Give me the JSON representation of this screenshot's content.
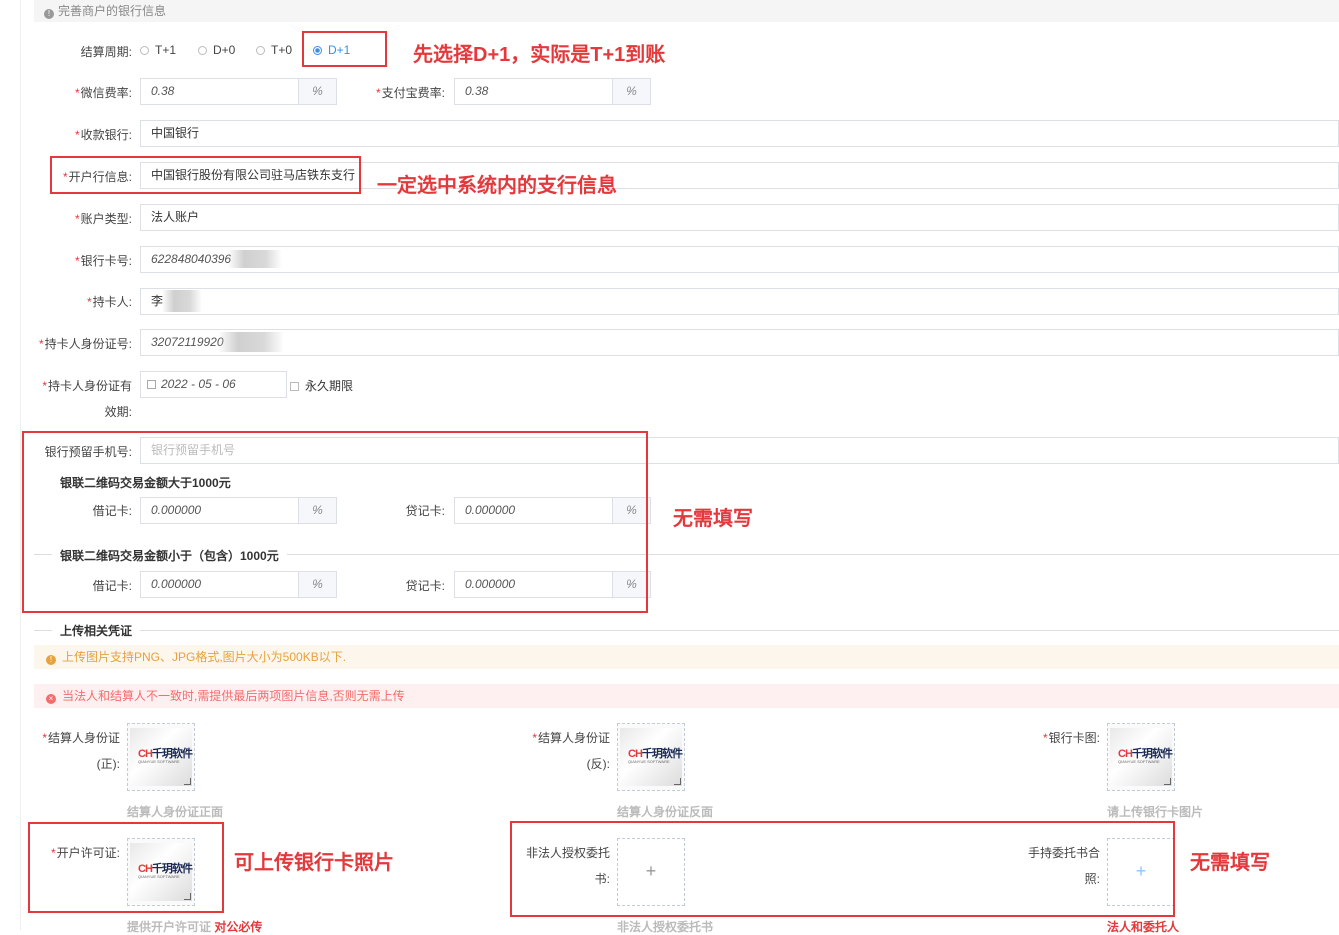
{
  "section_header": "完善商户的银行信息",
  "settlement": {
    "label": "结算周期:",
    "options": [
      "T+1",
      "D+0",
      "T+0",
      "D+1"
    ],
    "selected": "D+1"
  },
  "wechat_rate": {
    "label": "微信费率:",
    "value": "0.38",
    "unit": "%"
  },
  "alipay_rate": {
    "label": "支付宝费率:",
    "value": "0.38",
    "unit": "%"
  },
  "receiving_bank": {
    "label": "收款银行:",
    "value": "中国银行"
  },
  "branch_info": {
    "label": "开户行信息:",
    "value": "中国银行股份有限公司驻马店铁东支行"
  },
  "account_type": {
    "label": "账户类型:",
    "value": "法人账户"
  },
  "card_number": {
    "label": "银行卡号:",
    "value": "622848040396"
  },
  "card_holder": {
    "label": "持卡人:",
    "value": "李"
  },
  "holder_id": {
    "label": "持卡人身份证号:",
    "value": "32072119920"
  },
  "id_validity": {
    "label_line1": "持卡人身份证有",
    "label_line2": "效期:",
    "date": "2022 - 05 - 06",
    "permanent_label": "永久期限"
  },
  "bank_phone": {
    "label": "银行预留手机号:",
    "placeholder": "银行预留手机号"
  },
  "unionpay_over": {
    "title": "银联二维码交易金额大于1000元",
    "debit_label": "借记卡:",
    "debit_value": "0.000000",
    "credit_label": "贷记卡:",
    "credit_value": "0.000000",
    "unit": "%"
  },
  "unionpay_under": {
    "title": "银联二维码交易金额小于（包含）1000元",
    "debit_label": "借记卡:",
    "debit_value": "0.000000",
    "credit_label": "贷记卡:",
    "credit_value": "0.000000",
    "unit": "%"
  },
  "upload_section": {
    "title": "上传相关凭证",
    "warning": "上传图片支持PNG、JPG格式,图片大小为500KB以下.",
    "notice": "当法人和结算人不一致时,需提供最后两项图片信息,否则无需上传"
  },
  "uploads": {
    "id_front": {
      "label_line1": "结算人身份证",
      "label_line2": "(正):",
      "caption": "结算人身份证正面"
    },
    "id_back": {
      "label_line1": "结算人身份证",
      "label_line2": "(反):",
      "caption": "结算人身份证反面"
    },
    "bank_card": {
      "label": "银行卡图:",
      "caption": "请上传银行卡图片"
    },
    "account_permit": {
      "label": "开户许可证:",
      "caption": "提供开户许可证",
      "caption_red": "对公必传"
    },
    "authorization": {
      "label_line1": "非法人授权委托",
      "label_line2": "书:",
      "caption": "非法人授权委托书"
    },
    "hand_held": {
      "label_line1": "手持委托书合",
      "label_line2": "照:",
      "caption": "法人和委托人"
    }
  },
  "logo_text": {
    "mark": "CH",
    "name": "千玥软件",
    "sub": "QIANYUE SOFTWARE"
  },
  "annotations": {
    "settlement": "先选择D+1，实际是T+1到账",
    "branch": "一定选中系统内的支行信息",
    "no_fill_1": "无需填写",
    "upload_card": "可上传银行卡照片",
    "no_fill_2": "无需填写"
  },
  "colors": {
    "accent": "#3a8ee6",
    "annotation_red": "#e4393c"
  }
}
